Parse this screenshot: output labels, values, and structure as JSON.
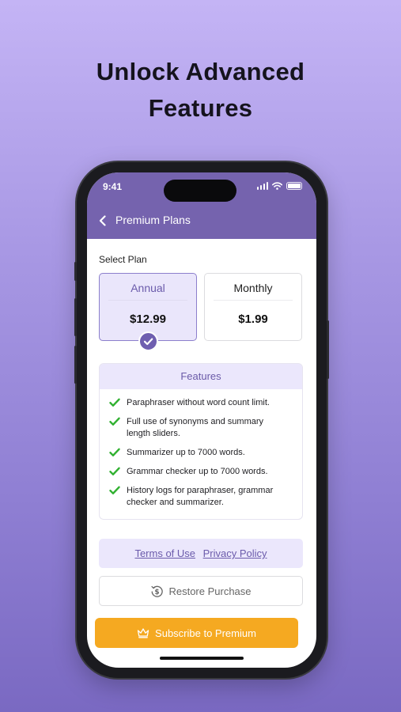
{
  "headline": {
    "line1": "Unlock Advanced",
    "line2": "Features"
  },
  "status_bar": {
    "time": "9:41"
  },
  "app_bar": {
    "title": "Premium Plans",
    "back_icon": "chevron-left-icon"
  },
  "plans": {
    "label": "Select Plan",
    "selected": "annual",
    "items": [
      {
        "name": "Annual",
        "price": "$12.99"
      },
      {
        "name": "Monthly",
        "price": "$1.99"
      }
    ]
  },
  "features": {
    "title": "Features",
    "items": [
      {
        "line1": "Paraphraser without word count limit.",
        "line2": ""
      },
      {
        "line1": "Full use of synonyms and summary",
        "line2": "length sliders."
      },
      {
        "line1": "Summarizer up to 7000 words.",
        "line2": ""
      },
      {
        "line1": "Grammar checker up to 7000 words.",
        "line2": ""
      },
      {
        "line1": "History logs for paraphraser, grammar",
        "line2": "checker and summarizer."
      }
    ]
  },
  "links": {
    "terms": "Terms of Use",
    "privacy": "Privacy Policy"
  },
  "restore": {
    "label": "Restore Purchase",
    "icon": "restore-dollar-icon"
  },
  "subscribe": {
    "label": "Subscribe to Premium",
    "icon": "crown-icon"
  },
  "colors": {
    "accent": "#7563ae",
    "plan_selected_bg": "#eae6fb",
    "check_green": "#2fb02f",
    "subscribe_bg": "#f5a921"
  }
}
